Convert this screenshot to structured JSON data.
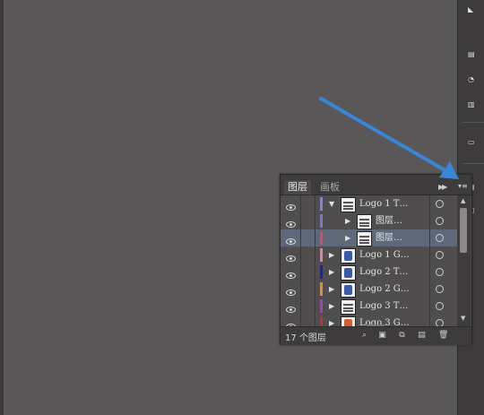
{
  "panel": {
    "tabs": [
      {
        "label": "图层"
      },
      {
        "label": "画板"
      }
    ],
    "layers": [
      {
        "name": "Logo 1 T…",
        "color": "#8d7fd8",
        "arrow": "expanded",
        "indent": 0,
        "thumb": "lines"
      },
      {
        "name": "图层…",
        "color": "#7f74d0",
        "arrow": "collapsed",
        "indent": 1,
        "thumb": "lines"
      },
      {
        "name": "图层…",
        "color": "#d05060",
        "arrow": "collapsed",
        "indent": 1,
        "thumb": "lines",
        "selected": true
      },
      {
        "name": "Logo 1 G…",
        "color": "#e07fb0",
        "arrow": "collapsed",
        "indent": 0,
        "thumb": "logo-blue"
      },
      {
        "name": "Logo 2 T…",
        "color": "#2020a0",
        "arrow": "collapsed",
        "indent": 0,
        "thumb": "logo-blue"
      },
      {
        "name": "Logo 2 G…",
        "color": "#e0902a",
        "arrow": "collapsed",
        "indent": 0,
        "thumb": "logo-blue"
      },
      {
        "name": "Logo 3 T…",
        "color": "#a040c0",
        "arrow": "collapsed",
        "indent": 0,
        "thumb": "lines"
      },
      {
        "name": "Logo 3 G…",
        "color": "#c03030",
        "arrow": "collapsed",
        "indent": 0,
        "thumb": "logo-orange"
      }
    ],
    "footer": {
      "count": "17 个图层"
    }
  },
  "icons": {
    "visibility": "eye-icon",
    "target": "target-circle-icon",
    "collapse": "double-chevron-right-icon",
    "menu": "panel-menu-icon"
  },
  "colors": {
    "canvas": "#5a5759",
    "panel": "#4a4849",
    "selected_row": "#5f6878",
    "arrow": "#3a86d6"
  }
}
